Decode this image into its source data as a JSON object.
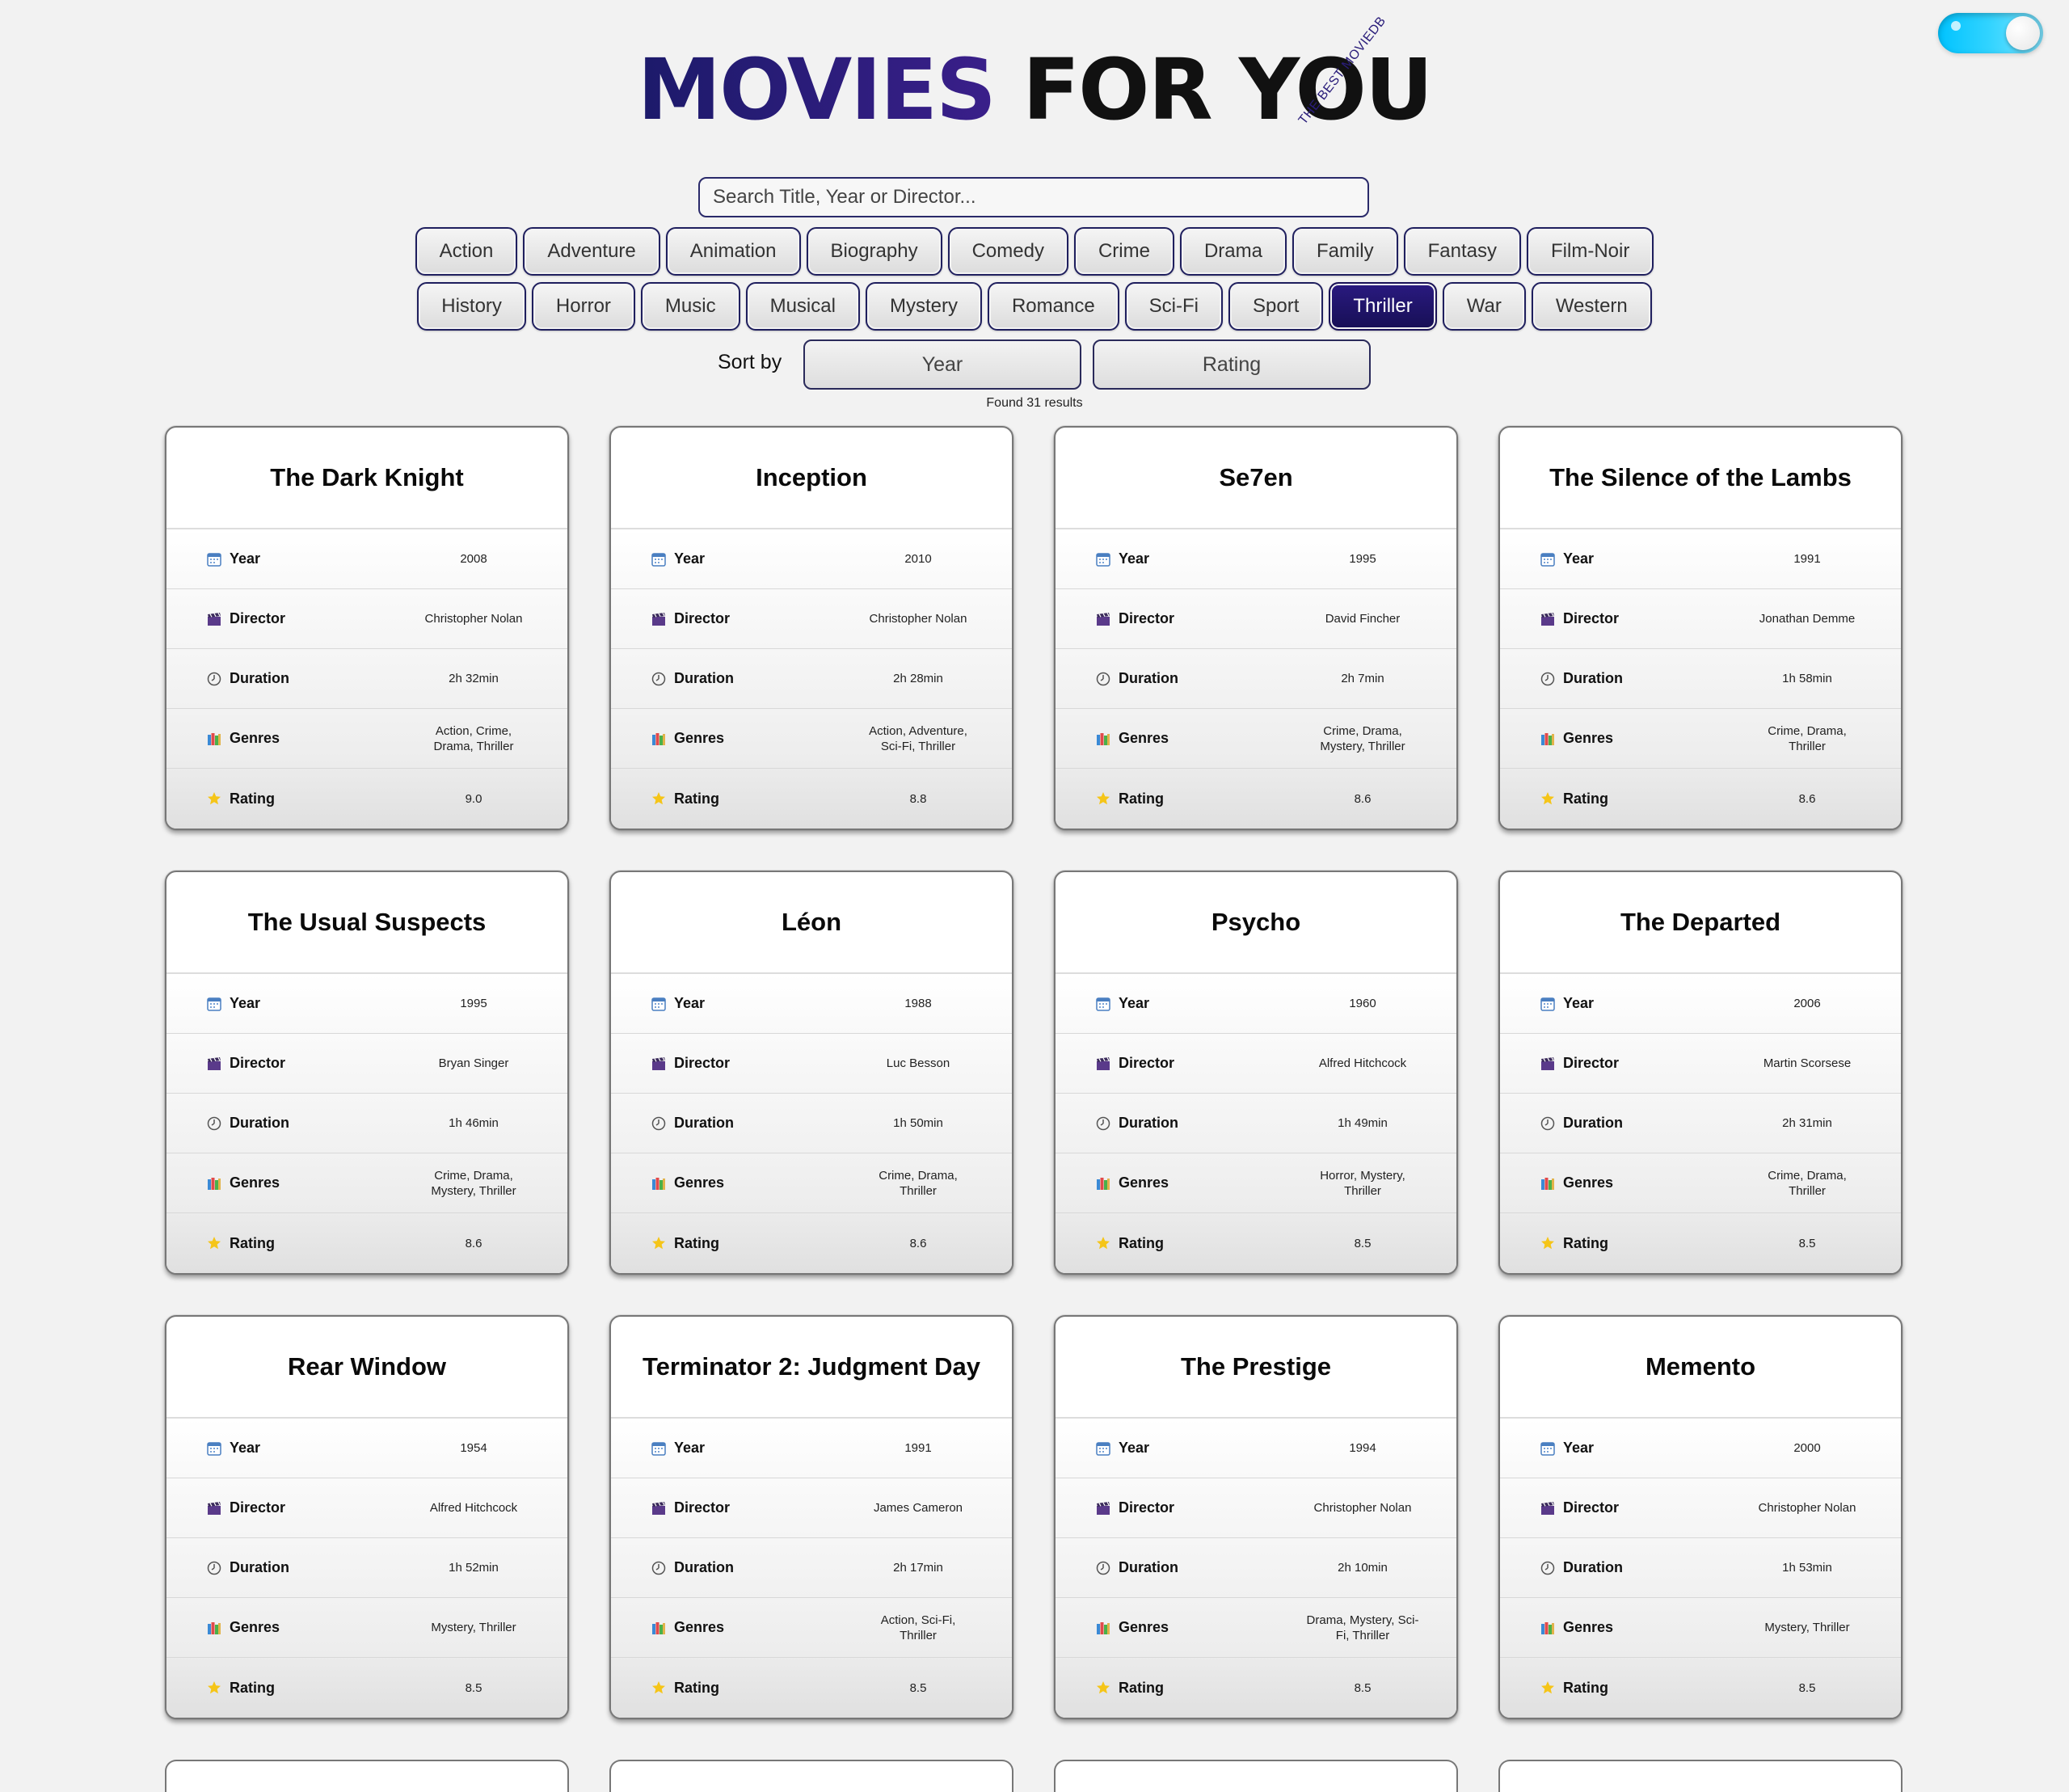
{
  "brand": {
    "accent": "MOVIES",
    "rest": "FOR YOU",
    "tagline": "THE BEST MOVIEDB"
  },
  "search": {
    "placeholder": "Search Title, Year or Director..."
  },
  "genres_row1": [
    "Action",
    "Adventure",
    "Animation",
    "Biography",
    "Comedy",
    "Crime",
    "Drama",
    "Family",
    "Fantasy",
    "Film-Noir"
  ],
  "genres_row2": [
    "History",
    "Horror",
    "Music",
    "Musical",
    "Mystery",
    "Romance",
    "Sci-Fi",
    "Sport",
    "Thriller",
    "War",
    "Western"
  ],
  "active_genre": "Thriller",
  "sort": {
    "label": "Sort by",
    "year": "Year",
    "rating": "Rating"
  },
  "results_text": "Found 31 results",
  "field_labels": {
    "year": "Year",
    "director": "Director",
    "duration": "Duration",
    "genres": "Genres",
    "rating": "Rating"
  },
  "colors": {
    "accent": "#1c1a6a",
    "active_chip": "#1f1570",
    "toggle": "#00c3ff"
  },
  "movies": [
    {
      "title": "The Dark Knight",
      "year": "2008",
      "director": "Christopher Nolan",
      "duration": "2h 32min",
      "genres": "Action, Crime, Drama, Thriller",
      "rating": "9.0"
    },
    {
      "title": "Inception",
      "year": "2010",
      "director": "Christopher Nolan",
      "duration": "2h 28min",
      "genres": "Action, Adventure, Sci-Fi, Thriller",
      "rating": "8.8"
    },
    {
      "title": "Se7en",
      "year": "1995",
      "director": "David Fincher",
      "duration": "2h 7min",
      "genres": "Crime, Drama, Mystery, Thriller",
      "rating": "8.6"
    },
    {
      "title": "The Silence of the Lambs",
      "year": "1991",
      "director": "Jonathan Demme",
      "duration": "1h 58min",
      "genres": "Crime, Drama, Thriller",
      "rating": "8.6"
    },
    {
      "title": "The Usual Suspects",
      "year": "1995",
      "director": "Bryan Singer",
      "duration": "1h 46min",
      "genres": "Crime, Drama, Mystery, Thriller",
      "rating": "8.6"
    },
    {
      "title": "Léon",
      "year": "1988",
      "director": "Luc Besson",
      "duration": "1h 50min",
      "genres": "Crime, Drama, Thriller",
      "rating": "8.6"
    },
    {
      "title": "Psycho",
      "year": "1960",
      "director": "Alfred Hitchcock",
      "duration": "1h 49min",
      "genres": "Horror, Mystery, Thriller",
      "rating": "8.5"
    },
    {
      "title": "The Departed",
      "year": "2006",
      "director": "Martin Scorsese",
      "duration": "2h 31min",
      "genres": "Crime, Drama, Thriller",
      "rating": "8.5"
    },
    {
      "title": "Rear Window",
      "year": "1954",
      "director": "Alfred Hitchcock",
      "duration": "1h 52min",
      "genres": "Mystery, Thriller",
      "rating": "8.5"
    },
    {
      "title": "Terminator 2: Judgment Day",
      "year": "1991",
      "director": "James Cameron",
      "duration": "2h 17min",
      "genres": "Action, Sci-Fi, Thriller",
      "rating": "8.5"
    },
    {
      "title": "The Prestige",
      "year": "1994",
      "director": "Christopher Nolan",
      "duration": "2h 10min",
      "genres": "Drama, Mystery, Sci-Fi, Thriller",
      "rating": "8.5"
    },
    {
      "title": "Memento",
      "year": "2000",
      "director": "Christopher Nolan",
      "duration": "1h 53min",
      "genres": "Mystery, Thriller",
      "rating": "8.5"
    }
  ]
}
